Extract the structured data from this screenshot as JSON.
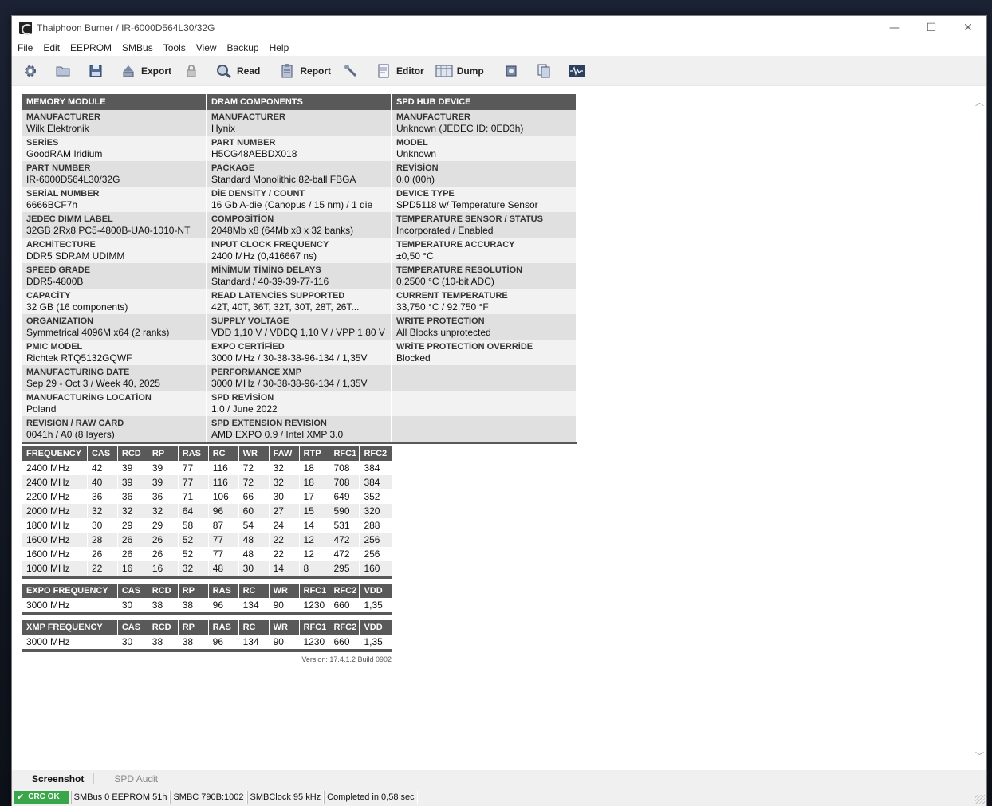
{
  "window": {
    "title": "Thaiphoon Burner / IR-6000D564L30/32G"
  },
  "controls": {
    "minimize": "—",
    "maximize": "☐",
    "close": "✕"
  },
  "menu": [
    "File",
    "Edit",
    "EEPROM",
    "SMBus",
    "Tools",
    "View",
    "Backup",
    "Help"
  ],
  "toolbar": {
    "export_label": "Export",
    "read_label": "Read",
    "report_label": "Report",
    "editor_label": "Editor",
    "dump_label": "Dump"
  },
  "memory_module": {
    "header": "MEMORY MODULE",
    "rows": [
      {
        "label": "MANUFACTURER",
        "value": "Wilk Elektronik"
      },
      {
        "label": "SERİES",
        "value": "GoodRAM Iridium"
      },
      {
        "label": "PART NUMBER",
        "value": "IR-6000D564L30/32G"
      },
      {
        "label": "SERİAL NUMBER",
        "value": "6666BCF7h"
      },
      {
        "label": "JEDEC DIMM LABEL",
        "value": "32GB 2Rx8 PC5-4800B-UA0-1010-NT"
      },
      {
        "label": "ARCHİTECTURE",
        "value": "DDR5 SDRAM UDIMM"
      },
      {
        "label": "SPEED GRADE",
        "value": "DDR5-4800B"
      },
      {
        "label": "CAPACİTY",
        "value": "32 GB (16 components)"
      },
      {
        "label": "ORGANİZATİON",
        "value": "Symmetrical 4096M x64 (2 ranks)"
      },
      {
        "label": "PMIC MODEL",
        "value": "Richtek RTQ5132GQWF"
      },
      {
        "label": "MANUFACTURİNG DATE",
        "value": "Sep 29 - Oct 3 / Week 40, 2025"
      },
      {
        "label": "MANUFACTURİNG LOCATİON",
        "value": "Poland"
      },
      {
        "label": "REVİSİON / RAW CARD",
        "value": "0041h / A0 (8 layers)"
      }
    ]
  },
  "dram_components": {
    "header": "DRAM COMPONENTS",
    "rows": [
      {
        "label": "MANUFACTURER",
        "value": "Hynix"
      },
      {
        "label": "PART NUMBER",
        "value": "H5CG48AEBDX018"
      },
      {
        "label": "PACKAGE",
        "value": "Standard Monolithic 82-ball FBGA"
      },
      {
        "label": "DİE DENSİTY / COUNT",
        "value": "16 Gb A-die (Canopus / 15 nm) / 1 die"
      },
      {
        "label": "COMPOSİTİON",
        "value": "2048Mb x8 (64Mb x8 x 32 banks)"
      },
      {
        "label": "INPUT CLOCK FREQUENCY",
        "value": "2400 MHz (0,416667 ns)"
      },
      {
        "label": "MİNİMUM TİMİNG DELAYS",
        "value": "Standard / 40-39-39-77-116"
      },
      {
        "label": "READ LATENCİES SUPPORTED",
        "value": "42T, 40T, 36T, 32T, 30T, 28T, 26T..."
      },
      {
        "label": "SUPPLY VOLTAGE",
        "value": "VDD 1,10 V / VDDQ 1,10 V / VPP 1,80 V"
      },
      {
        "label": "EXPO CERTİFİED",
        "value": "3000 MHz / 30-38-38-96-134 / 1,35V"
      },
      {
        "label": "PERFORMANCE XMP",
        "value": "3000 MHz / 30-38-38-96-134 / 1,35V"
      },
      {
        "label": "SPD REVİSİON",
        "value": "1.0 / June 2022"
      },
      {
        "label": "SPD EXTENSİON REVİSİON",
        "value": "AMD EXPO 0.9 / Intel XMP 3.0"
      }
    ]
  },
  "spd_hub": {
    "header": "SPD HUB DEVICE",
    "rows": [
      {
        "label": "MANUFACTURER",
        "value": "Unknown (JEDEC ID: 0ED3h)"
      },
      {
        "label": "MODEL",
        "value": "Unknown"
      },
      {
        "label": "REVİSİON",
        "value": "0.0 (00h)"
      },
      {
        "label": "DEVICE TYPE",
        "value": "SPD5118 w/ Temperature Sensor"
      },
      {
        "label": "TEMPERATURE SENSOR / STATUS",
        "value": "Incorporated / Enabled"
      },
      {
        "label": "TEMPERATURE ACCURACY",
        "value": "±0,50 °C"
      },
      {
        "label": "TEMPERATURE RESOLUTİON",
        "value": "0,2500 °C (10-bit ADC)"
      },
      {
        "label": "CURRENT TEMPERATURE",
        "value": "33,750 °C / 92,750 °F"
      },
      {
        "label": "WRİTE PROTECTİON",
        "value": "All Blocks unprotected"
      },
      {
        "label": "WRİTE PROTECTİON OVERRİDE",
        "value": "Blocked"
      },
      {
        "label": "",
        "value": ""
      },
      {
        "label": "",
        "value": ""
      },
      {
        "label": "",
        "value": ""
      }
    ]
  },
  "jedec_timings": {
    "headers": [
      "FREQUENCY",
      "CAS",
      "RCD",
      "RP",
      "RAS",
      "RC",
      "WR",
      "FAW",
      "RTP",
      "RFC1",
      "RFC2"
    ],
    "rows": [
      [
        "2400 MHz",
        "42",
        "39",
        "39",
        "77",
        "116",
        "72",
        "32",
        "18",
        "708",
        "384"
      ],
      [
        "2400 MHz",
        "40",
        "39",
        "39",
        "77",
        "116",
        "72",
        "32",
        "18",
        "708",
        "384"
      ],
      [
        "2200 MHz",
        "36",
        "36",
        "36",
        "71",
        "106",
        "66",
        "30",
        "17",
        "649",
        "352"
      ],
      [
        "2000 MHz",
        "32",
        "32",
        "32",
        "64",
        "96",
        "60",
        "27",
        "15",
        "590",
        "320"
      ],
      [
        "1800 MHz",
        "30",
        "29",
        "29",
        "58",
        "87",
        "54",
        "24",
        "14",
        "531",
        "288"
      ],
      [
        "1600 MHz",
        "28",
        "26",
        "26",
        "52",
        "77",
        "48",
        "22",
        "12",
        "472",
        "256"
      ],
      [
        "1600 MHz",
        "26",
        "26",
        "26",
        "52",
        "77",
        "48",
        "22",
        "12",
        "472",
        "256"
      ],
      [
        "1000 MHz",
        "22",
        "16",
        "16",
        "32",
        "48",
        "30",
        "14",
        "8",
        "295",
        "160"
      ]
    ]
  },
  "expo_timings": {
    "headers": [
      "EXPO FREQUENCY",
      "CAS",
      "RCD",
      "RP",
      "RAS",
      "RC",
      "WR",
      "RFC1",
      "RFC2",
      "VDD"
    ],
    "rows": [
      [
        "3000 MHz",
        "30",
        "38",
        "38",
        "96",
        "134",
        "90",
        "1230",
        "660",
        "1,35"
      ]
    ]
  },
  "xmp_timings": {
    "headers": [
      "XMP FREQUENCY",
      "CAS",
      "RCD",
      "RP",
      "RAS",
      "RC",
      "WR",
      "RFC1",
      "RFC2",
      "VDD"
    ],
    "rows": [
      [
        "3000 MHz",
        "30",
        "38",
        "38",
        "96",
        "134",
        "90",
        "1230",
        "660",
        "1,35"
      ]
    ]
  },
  "version": "Version: 17.4.1.2 Build 0902",
  "tabs": {
    "screenshot": "Screenshot",
    "spd_audit": "SPD Audit"
  },
  "status": {
    "crc": "CRC OK",
    "smbus": "SMBus 0 EEPROM 51h",
    "smbc": "SMBC 790B:1002",
    "clock": "SMBClock 95 kHz",
    "completed": "Completed in 0,58 sec"
  }
}
